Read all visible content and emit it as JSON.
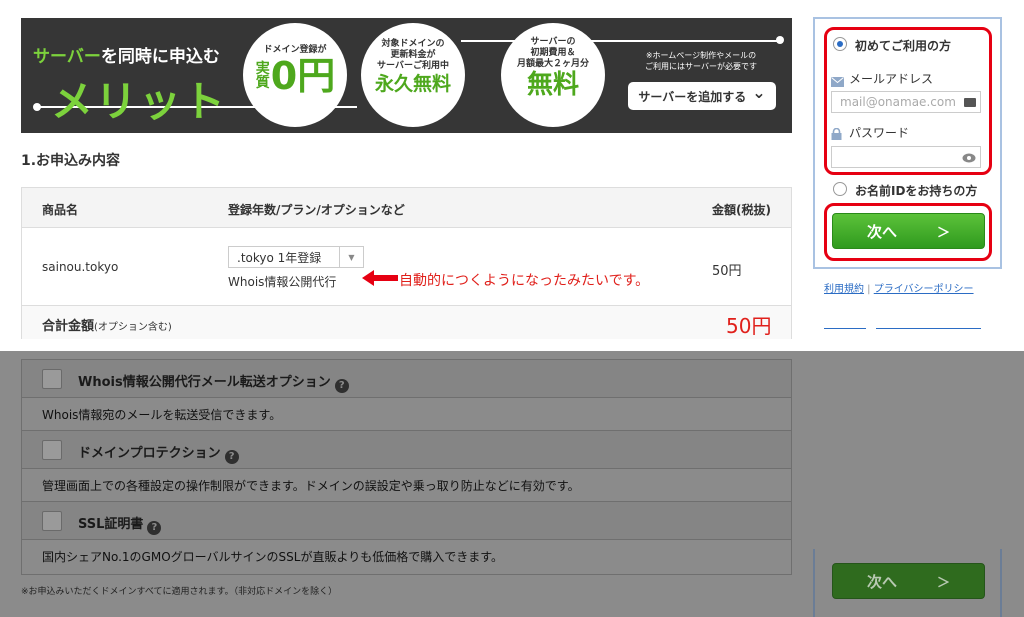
{
  "banner": {
    "subtitle_green": "サーバー",
    "subtitle_rest": "を同時に申込む",
    "title": "メリット",
    "circle1": {
      "top": "ドメイン登録が",
      "side": "実質",
      "value": "0円"
    },
    "circle2": {
      "top": "対象ドメインの\n更新料金が\nサーバーご利用中",
      "value": "永久無料"
    },
    "circle3": {
      "top": "サーバーの\n初期費用＆\n月額最大２ヶ月分",
      "value": "無料"
    },
    "note": "※ホームページ制作やメールの\nご利用にはサーバーが必要です",
    "add_server_button": "サーバーを追加する",
    "chevron": "⌄"
  },
  "order": {
    "section_title": "1.お申込み内容",
    "headers": {
      "product": "商品名",
      "plan": "登録年数/プラン/オプションなど",
      "price": "金額(税抜)"
    },
    "row": {
      "product": "sainou.tokyo",
      "plan_select": ".tokyo 1年登録",
      "whois": "Whois情報公開代行",
      "annotation": "自動的につくようになったみたいです。",
      "price": "50円"
    },
    "total_label": "合計金額",
    "total_note": "(オプション含む)",
    "total_value": "50円"
  },
  "login": {
    "first_time": "初めてご利用の方",
    "email_label": "メールアドレス",
    "email_placeholder": "mail@onamae.com",
    "password_label": "パスワード",
    "have_id": "お名前IDをお持ちの方",
    "next_label": "次へ",
    "next_arrow": "＞",
    "terms_link": "利用規約",
    "privacy_link": "プライバシーポリシー"
  },
  "options": {
    "items": [
      {
        "title": "Whois情報公開代行メール転送オプション",
        "desc": "Whois情報宛のメールを転送受信できます。"
      },
      {
        "title": "ドメインプロテクション",
        "desc": "管理画面上での各種設定の操作制限ができます。ドメインの誤設定や乗っ取り防止などに有効です。"
      },
      {
        "title": "SSL証明書",
        "desc": "国内シェアNo.1のGMOグローバルサインのSSLが直販よりも低価格で購入できます。"
      }
    ],
    "help_glyph": "?",
    "footnote": "※お申込みいただくドメインすべてに適用されます。（非対応ドメインを除く）",
    "next_label": "次へ",
    "next_arrow": "＞"
  },
  "colors": {
    "accent_green": "#4ea81d",
    "highlight_red": "#e60012",
    "link_blue": "#2b6cc4"
  }
}
